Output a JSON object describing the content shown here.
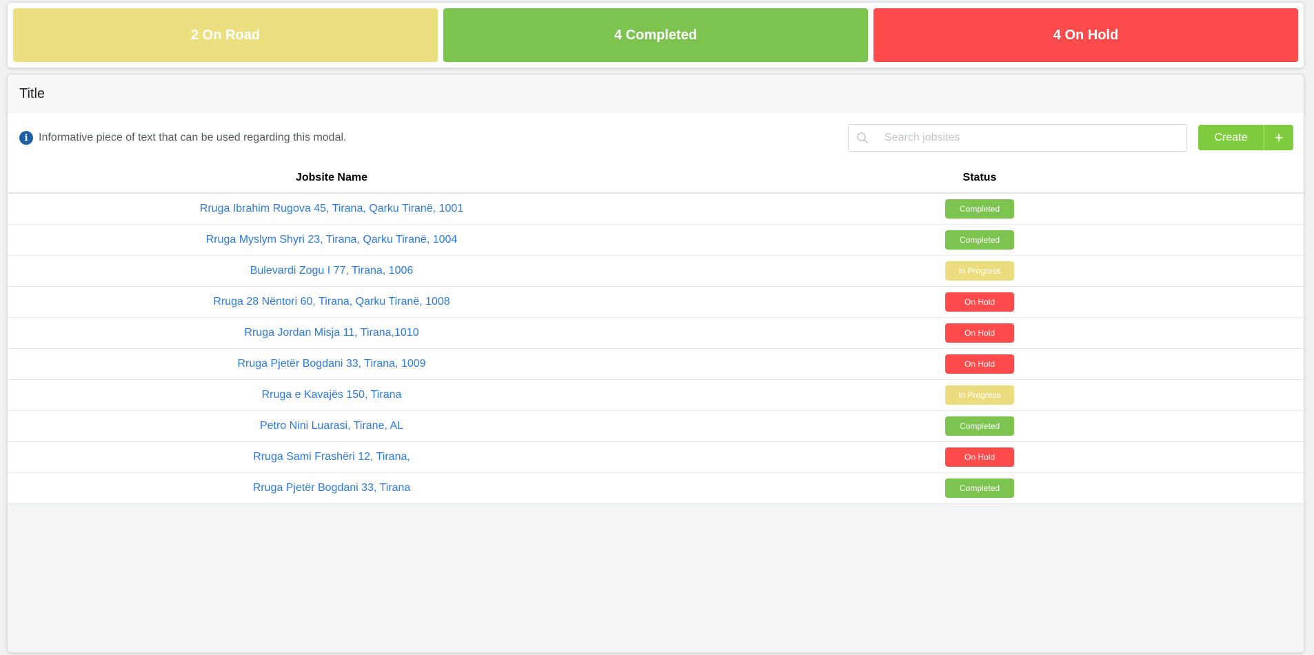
{
  "stats": [
    {
      "label": "2 On Road",
      "color": "#ebdf80"
    },
    {
      "label": "4 Completed",
      "color": "#7cc34f"
    },
    {
      "label": "4 On Hold",
      "color": "#ff4b4b"
    }
  ],
  "modal": {
    "title": "Title",
    "info_text": "Informative piece of text that can be used regarding this modal.",
    "info_icon": "info-icon"
  },
  "search": {
    "placeholder": "Search jobsites",
    "icon": "search-icon"
  },
  "create_button": {
    "label": "Create",
    "plus": "+"
  },
  "table": {
    "headers": {
      "name": "Jobsite Name",
      "status": "Status"
    },
    "rows": [
      {
        "name": "Rruga Ibrahim Rugova 45, Tirana, Qarku Tiranë, 1001",
        "status": "Completed",
        "kind": "completed"
      },
      {
        "name": "Rruga Myslym Shyri 23, Tirana, Qarku Tiranë, 1004",
        "status": "Completed",
        "kind": "completed"
      },
      {
        "name": "Bulevardi Zogu I 77, Tirana, 1006",
        "status": "In Progress",
        "kind": "progress"
      },
      {
        "name": "Rruga 28 Nëntori 60, Tirana, Qarku Tiranë, 1008",
        "status": "On Hold",
        "kind": "hold"
      },
      {
        "name": "Rruga Jordan Misja 11, Tirana,1010",
        "status": "On Hold",
        "kind": "hold"
      },
      {
        "name": "Rruga Pjetër Bogdani 33, Tirana, 1009",
        "status": "On Hold",
        "kind": "hold"
      },
      {
        "name": "Rruga e Kavajës 150, Tirana",
        "status": "In Progress",
        "kind": "progress"
      },
      {
        "name": "Petro Nini Luarasi, Tirane, AL",
        "status": "Completed",
        "kind": "completed"
      },
      {
        "name": "Rruga Sami Frashëri 12, Tirana,",
        "status": "On Hold",
        "kind": "hold"
      },
      {
        "name": "Rruga Pjetër Bogdani 33, Tirana",
        "status": "Completed",
        "kind": "completed"
      }
    ]
  }
}
